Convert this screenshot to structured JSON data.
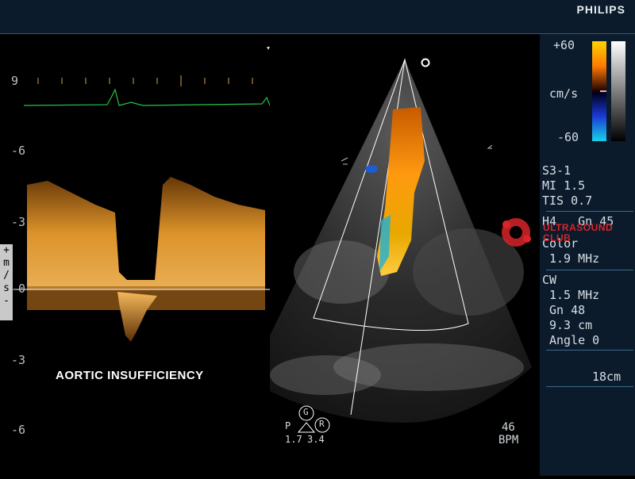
{
  "header": {
    "brand": "PHILIPS"
  },
  "doppler": {
    "ticks": [
      "9",
      "-6",
      "-3",
      "-0",
      "-3",
      "-6"
    ],
    "axis_unit": "+\nm\n/\ns\n-",
    "caption": "AORTIC INSUFFICIENCY"
  },
  "color_scale": {
    "max": "+60",
    "min": "-60",
    "unit": "cm/s"
  },
  "settings": {
    "probe": "S3-1",
    "mi": "MI 1.5",
    "tis": "TIS 0.7",
    "h_gain": "H4   Gn 45",
    "color_label": "Color",
    "color_freq": "1.9 MHz",
    "cw_label": "CW",
    "cw_freq": "1.5 MHz",
    "cw_gain": "Gn 48",
    "cw_depth": "9.3 cm",
    "cw_angle": "Angle 0",
    "depth": "18cm"
  },
  "indicators": {
    "p": "P",
    "g": "G",
    "r": "R",
    "v1": "1.7",
    "v2": "3.4"
  },
  "heart_rate": {
    "value": "46",
    "unit": "BPM"
  },
  "watermark": {
    "line1": "ULTRASOUND",
    "line2": "CLUB"
  },
  "colors": {
    "flow_warm": "#ff8c00",
    "flow_cool": "#1e5bd6",
    "spectrum": "#e89a2c",
    "ecg": "#27c24a"
  }
}
